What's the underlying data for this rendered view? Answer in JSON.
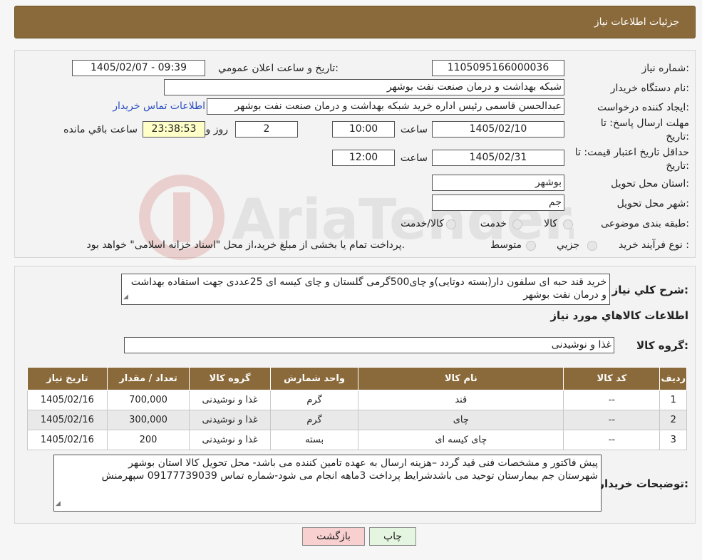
{
  "header": {
    "title": "جزئیات اطلاعات نیاز"
  },
  "form": {
    "need_number_label": "شماره نیاز:",
    "need_number": "1105095166000036",
    "announce_label": "تاریخ و ساعت اعلان عمومي:",
    "announce_value": "1405/02/07 - 09:39",
    "buyer_label": "نام دستگاه خريدار:",
    "buyer_value": "شبکه بهداشت و درمان صنعت نفت بوشهر",
    "creator_label": "ايجاد کننده درخواست:",
    "creator_value": "عبدالحسن قاسمی رئیس اداره خرید  شبکه بهداشت و درمان صنعت نفت بوشهر",
    "contact_link": "اطلاعات تماس خريدار",
    "deadline_label_1": "مهلت ارسال پاسخ: تا",
    "deadline_label_2": "تاريخ:",
    "deadline_date": "1405/02/10",
    "time_label": "ساعت",
    "deadline_time": "10:00",
    "days_value": "2",
    "days_label": "روز و",
    "remaining_value": "23:38:53",
    "remaining_label": "ساعت باقي مانده",
    "validity_label_1": "حداقل تاريخ اعتبار قيمت: تا",
    "validity_label_2": "تاريخ:",
    "validity_date": "1405/02/31",
    "validity_time": "12:00",
    "province_label": "استان محل تحويل:",
    "province_value": "بوشهر",
    "city_label": "شهر محل تحويل:",
    "city_value": "جم",
    "category_label": "طبقه بندی موضوعی:",
    "category_options": [
      "کالا",
      "خدمت",
      "کالا/خدمت"
    ],
    "process_label": "نوع فرآيند خريد :",
    "process_options": [
      "جزيي",
      "متوسط"
    ],
    "process_note": "پرداخت تمام يا بخشی از مبلغ خريد،از محل \"اسناد خزانه اسلامی\" خواهد بود."
  },
  "summary": {
    "label": "شرح کلي نياز:",
    "text": "خرید قند حبه ای سلفون دار(بسته دوتایی)و چای500گرمی گلستان و چای کیسه ای 25عددی جهت استفاده بهداشت و درمان نفت بوشهر",
    "goods_info_title": "اطلاعات کالاهاي مورد نياز",
    "group_label": "گروه کالا:",
    "group_value": "غذا و نوشيدنی"
  },
  "table": {
    "headers": [
      "رديف",
      "کد کالا",
      "نام کالا",
      "واحد شمارش",
      "گروه کالا",
      "تعداد / مقدار",
      "تاريخ نياز"
    ],
    "rows": [
      [
        "1",
        "--",
        "قند",
        "گرم",
        "غذا و نوشيدنی",
        "700,000",
        "1405/02/16"
      ],
      [
        "2",
        "--",
        "چای",
        "گرم",
        "غذا و نوشيدنی",
        "300,000",
        "1405/02/16"
      ],
      [
        "3",
        "--",
        "چای کیسه ای",
        "بسته",
        "غذا و نوشيدنی",
        "200",
        "1405/02/16"
      ]
    ]
  },
  "notes": {
    "label": "توضيحات خريدار:",
    "line1": "پیش فاکتور و مشخصات فنی قید گردد –هزینه ارسال به عهده تامین کننده می باشد- محل تحویل کالا استان بوشهر",
    "line2": "شهرستان جم بیمارستان توحید می باشدشرایط پرداخت 3ماهه انجام می شود-شماره تماس 09177739039 سپهرمنش"
  },
  "buttons": {
    "print": "چاپ",
    "back": "بازگشت"
  },
  "watermark": {
    "text": "AriaTender.neT"
  },
  "colors": {
    "header_bg": "#8a6a3a",
    "link": "#2b4fc0",
    "back_button": "#f8d0d0",
    "print_button": "#e4f6e0"
  }
}
